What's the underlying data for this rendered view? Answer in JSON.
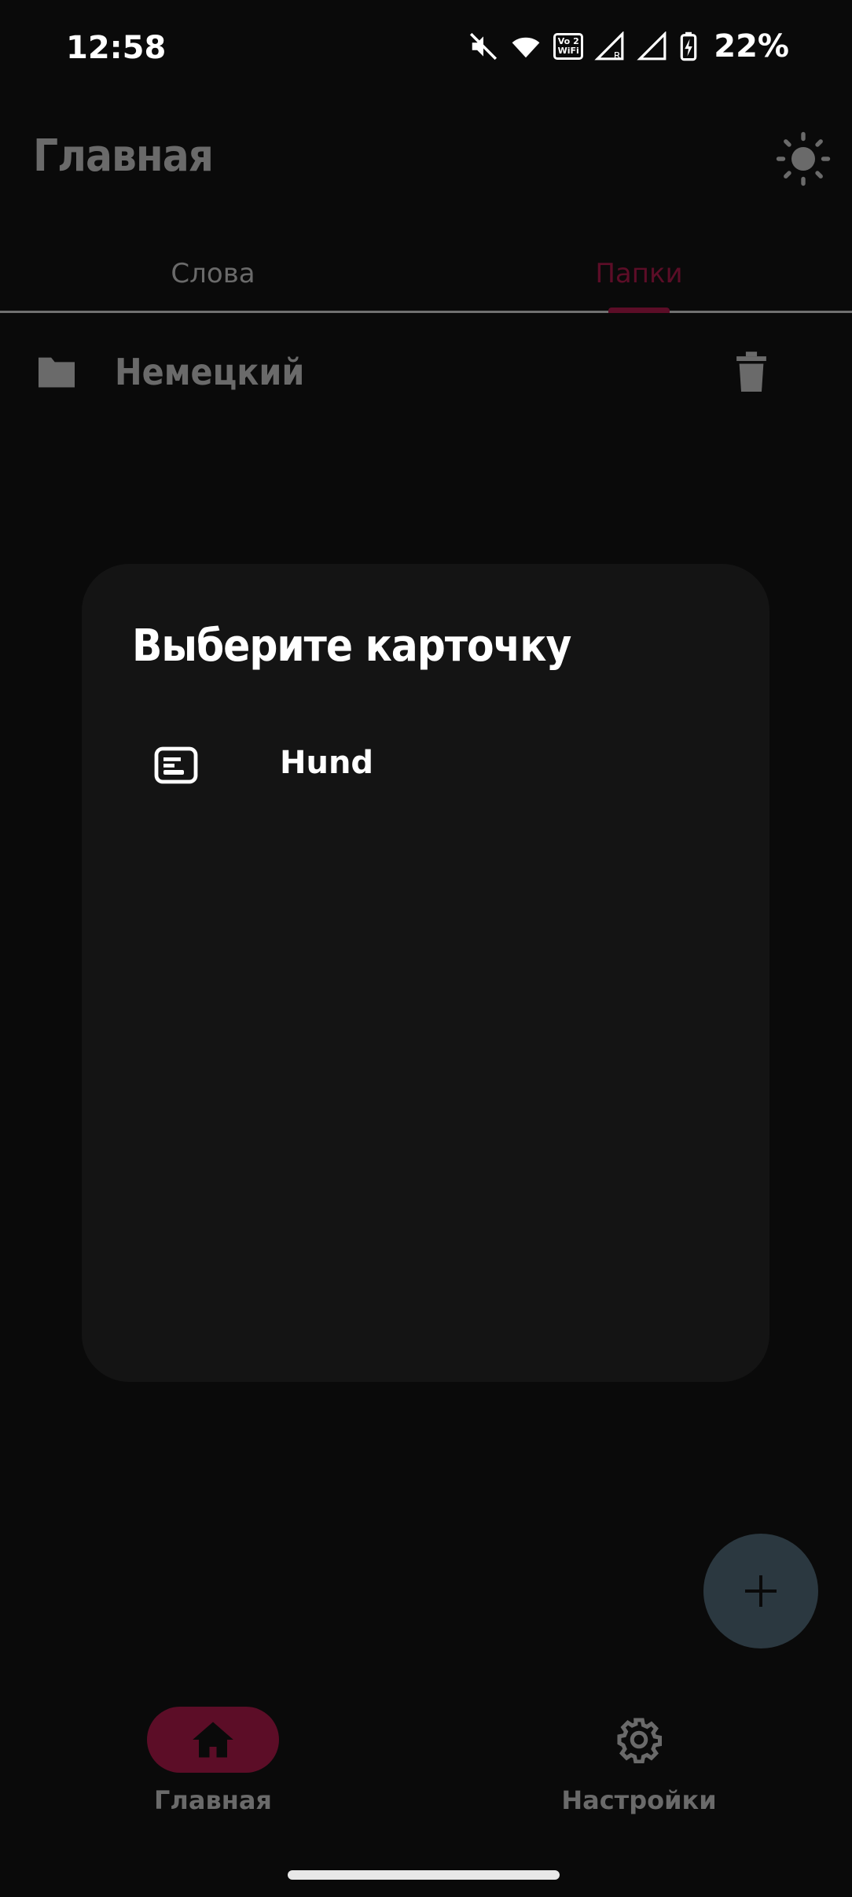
{
  "status_bar": {
    "time": "12:58",
    "battery_percent": "22%",
    "volte_label": "Vo 2 WiFi",
    "icons": [
      "mute-icon",
      "wifi-icon",
      "volte-wifi-icon",
      "signal-r-icon",
      "signal-icon",
      "battery-charging-icon"
    ]
  },
  "app_bar": {
    "title": "Главная",
    "theme_icon": "sun-icon"
  },
  "tabs": [
    {
      "label": "Слова",
      "selected": false
    },
    {
      "label": "Папки",
      "selected": true
    }
  ],
  "folders": [
    {
      "name": "Немецкий",
      "icon": "folder-icon",
      "action_icon": "trash-icon"
    }
  ],
  "dialog": {
    "title": "Выберите карточку",
    "items": [
      {
        "label": "Hund",
        "icon": "card-icon"
      }
    ]
  },
  "fab": {
    "icon": "plus-icon"
  },
  "bottom_nav": [
    {
      "label": "Главная",
      "icon": "home-icon",
      "selected": true
    },
    {
      "label": "Настройки",
      "icon": "gear-icon",
      "selected": false
    }
  ],
  "colors": {
    "background": "#0a0a0a",
    "accent": "#5c0d27",
    "dialog_surface": "#141414",
    "fab": "#2b3840"
  }
}
